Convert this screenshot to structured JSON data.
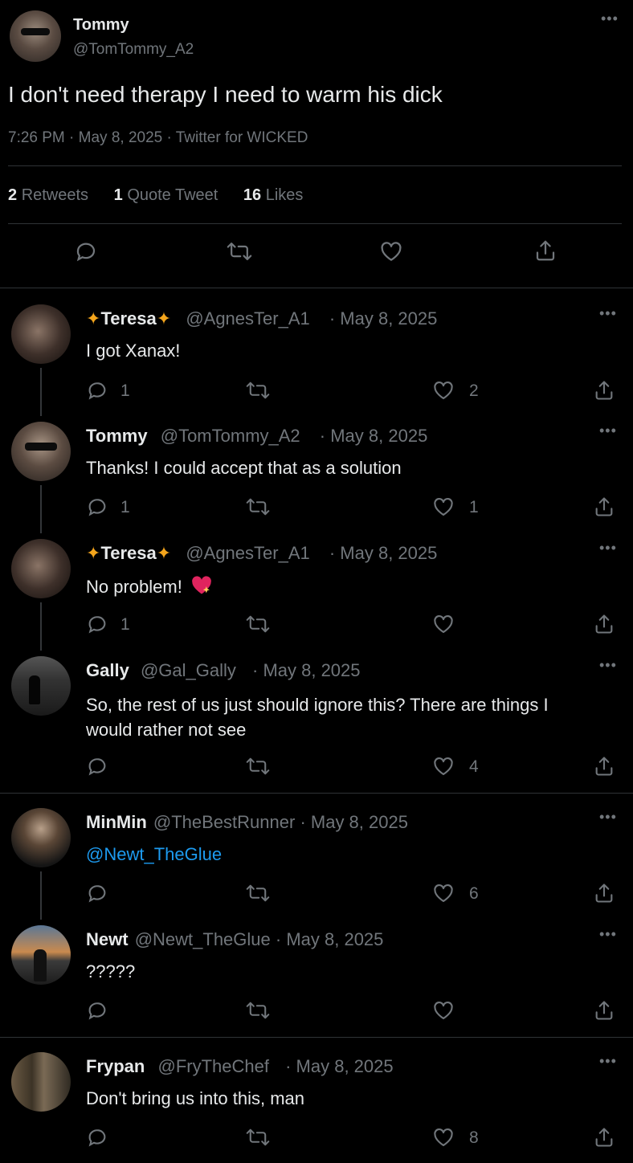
{
  "main_tweet": {
    "name": "Tommy",
    "handle": "@TomTommy_A2",
    "text": "I don't need therapy I need to warm his dick",
    "meta": "7:26 PM · May 8, 2025 · Twitter for WICKED",
    "stats": {
      "retweets_count": "2",
      "retweets_label": "Retweets",
      "quotes_count": "1",
      "quotes_label": "Quote Tweet",
      "likes_count": "16",
      "likes_label": "Likes"
    }
  },
  "replies": [
    {
      "name": "Teresa",
      "handle": "@AgnesTer_A1",
      "date": "· May 8, 2025",
      "text": "I got Xanax!",
      "reply_count": "1",
      "like_count": "2"
    },
    {
      "name": "Tommy",
      "handle": "@TomTommy_A2",
      "date": "· May 8, 2025",
      "text": "Thanks! I could accept that as a solution",
      "reply_count": "1",
      "like_count": "1"
    },
    {
      "name": "Teresa",
      "handle": "@AgnesTer_A1",
      "date": "· May 8, 2025",
      "text": "No problem!",
      "reply_count": "1",
      "like_count": ""
    },
    {
      "name": "Gally",
      "handle": "@Gal_Gally",
      "date": "· May 8, 2025",
      "text": "So, the rest of us just should ignore this? There are things I would rather not see",
      "reply_count": "",
      "like_count": "4"
    },
    {
      "name": "MinMin",
      "handle": "@TheBestRunner",
      "date": "· May 8, 2025",
      "text": "@Newt_TheGlue",
      "reply_count": "",
      "like_count": "6"
    },
    {
      "name": "Newt",
      "handle": "@Newt_TheGlue",
      "date": "· May 8, 2025",
      "text": "?????",
      "reply_count": "",
      "like_count": ""
    },
    {
      "name": "Frypan",
      "handle": "@FryTheChef",
      "date": "· May 8, 2025",
      "text": "Don't bring us into this, man",
      "reply_count": "",
      "like_count": "8"
    }
  ],
  "colors": {
    "background": "#000000",
    "text": "#e7e9ea",
    "muted": "#71767b",
    "link": "#1d9bf0",
    "divider": "#2f3336"
  }
}
